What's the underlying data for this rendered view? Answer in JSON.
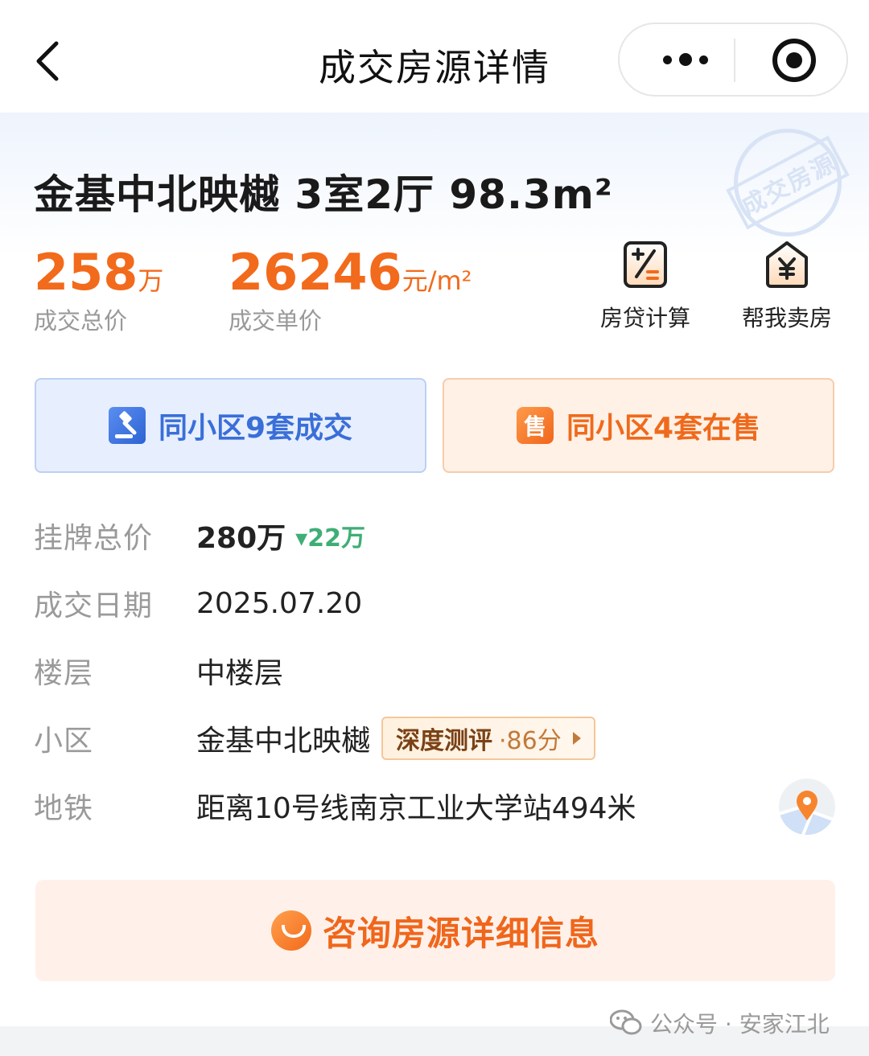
{
  "nav": {
    "title": "成交房源详情"
  },
  "listing": {
    "title": "金基中北映樾 3室2厅 98.3m²",
    "stamp": "成交房源",
    "total_price": {
      "value": "258",
      "unit": "万",
      "label": "成交总价"
    },
    "unit_price": {
      "value": "26246",
      "unit": "元/m²",
      "label": "成交单价"
    }
  },
  "tools": {
    "loan_label": "房贷计算",
    "sell_label": "帮我卖房",
    "loan_icon": "calculator-icon",
    "sell_icon": "house-yuan-icon"
  },
  "buttons": {
    "sold_label": "同小区9套成交",
    "sale_label": "同小区4套在售",
    "sale_badge": "售"
  },
  "details": {
    "list_price": {
      "key": "挂牌总价",
      "value": "280万",
      "drop": "▾22万"
    },
    "deal_date": {
      "key": "成交日期",
      "value": "2025.07.20"
    },
    "floor": {
      "key": "楼层",
      "value": "中楼层"
    },
    "community": {
      "key": "小区",
      "value": "金基中北映樾",
      "review_label": "深度测评",
      "review_score": "·86分"
    },
    "subway": {
      "key": "地铁",
      "value": "距离10号线南京工业大学站494米"
    }
  },
  "consult": {
    "label": "咨询房源详细信息"
  },
  "watermark": {
    "text": "公众号 · 安家江北"
  },
  "colors": {
    "accent_orange": "#f26a1b",
    "accent_blue": "#3a6fd8",
    "drop_green": "#3fae76"
  }
}
